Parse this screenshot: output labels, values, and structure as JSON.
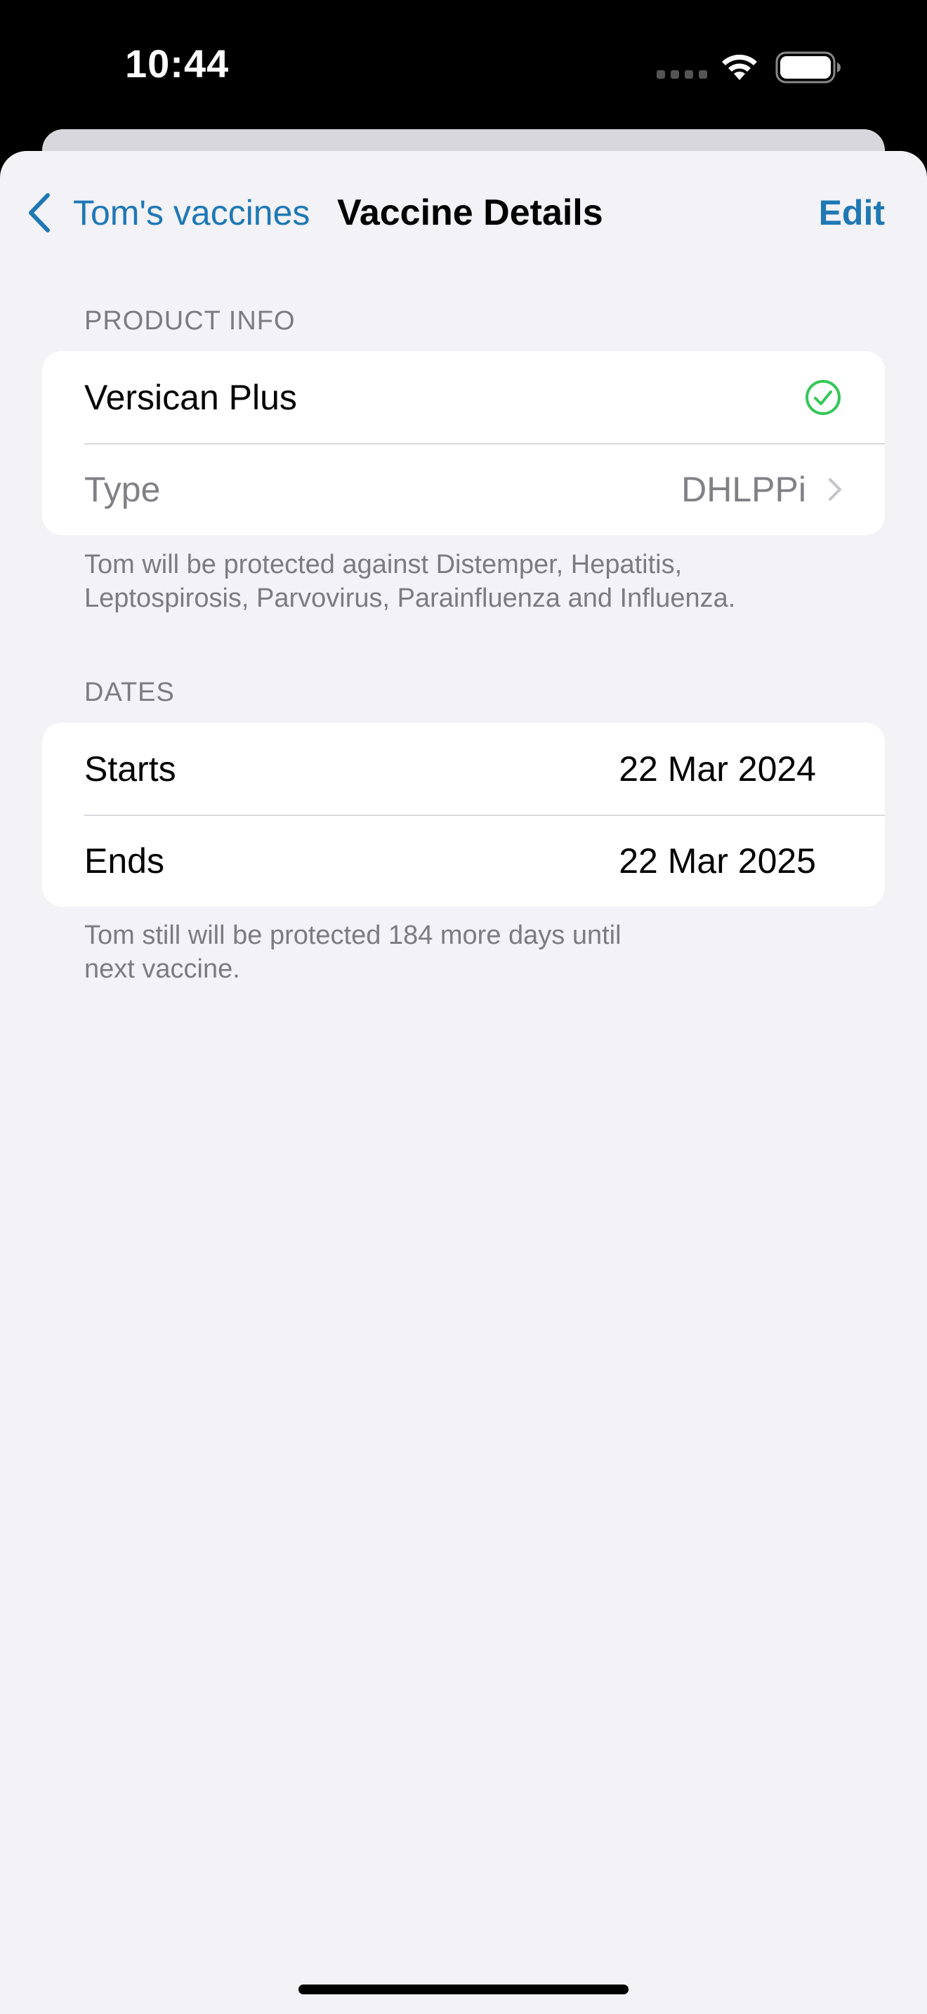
{
  "status_bar": {
    "time": "10:44"
  },
  "nav": {
    "back_label": "Tom's vaccines",
    "title": "Vaccine Details",
    "edit_label": "Edit"
  },
  "product_info": {
    "header": "PRODUCT INFO",
    "product_name": "Versican Plus",
    "type_label": "Type",
    "type_value": "DHLPPi",
    "note_line1": "Tom will be protected against Distemper, Hepatitis,",
    "note_line2": "Leptospirosis, Parvovirus, Parainfluenza and Influenza."
  },
  "dates": {
    "header": "DATES",
    "starts_label": "Starts",
    "starts_value": "22 Mar 2024",
    "ends_label": "Ends",
    "ends_value": "22 Mar 2025",
    "note_line1": "Tom still will be protected 184 more days until",
    "note_line2": "next vaccine."
  },
  "colors": {
    "accent": "#1f78b4",
    "success": "#34c759",
    "background": "#f2f2f7",
    "secondary_text": "#7b7b80"
  },
  "icons": {
    "back": "chevron-left-icon",
    "verified": "checkmark-circle-icon",
    "disclosure": "chevron-right-icon",
    "wifi": "wifi-icon",
    "battery": "battery-icon"
  }
}
